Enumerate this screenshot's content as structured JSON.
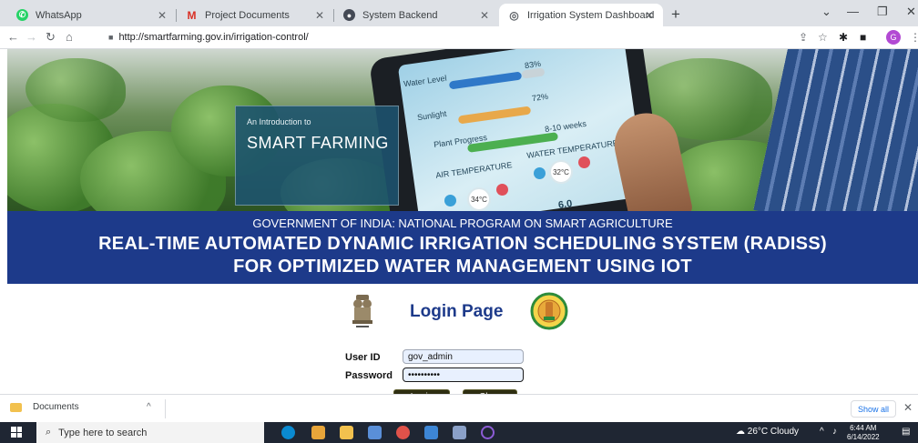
{
  "browser": {
    "tabs": [
      {
        "label": "WhatsApp",
        "icon": "whatsapp-icon",
        "color": "#25d366",
        "active": false
      },
      {
        "label": "Project Documents",
        "icon": "gmail-icon",
        "color": "#d93025",
        "active": false
      },
      {
        "label": "System Backend",
        "icon": "app-icon",
        "color": "#444a55",
        "active": false
      },
      {
        "label": "Irrigation System Dashboard",
        "icon": "globe-icon",
        "color": "#5f6368",
        "active": true
      }
    ],
    "new_tab": "+",
    "url": "http://smartfarming.gov.in/irrigation-control/",
    "profile_initial": "G"
  },
  "banner": {
    "intro_small": "An Introduction to",
    "intro_big": "SMART FARMING",
    "tablet": {
      "water_level": "Water Level",
      "water_pct": "83%",
      "sunlight": "Sunlight",
      "sun_pct": "72%",
      "plant_progress": "Plant Progress",
      "plant_weeks": "8-10 weeks",
      "water_temp": "WATER TEMPERATURE",
      "water_temp_val": "32°C",
      "air_temp": "AIR TEMPERATURE",
      "air_temp_val": "34°C",
      "ph_val": "6.0"
    }
  },
  "header": {
    "subtitle": "GOVERNMENT OF INDIA: NATIONAL PROGRAM ON SMART AGRICULTURE",
    "title_line1": "REAL-TIME AUTOMATED DYNAMIC IRRIGATION SCHEDULING SYSTEM (RADISS)",
    "title_line2": "FOR OPTIMIZED WATER MANAGEMENT USING IOT"
  },
  "login": {
    "heading": "Login Page",
    "user_id_label": "User ID",
    "user_id_value": "gov_admin",
    "password_label": "Password",
    "password_value": "••••••••••",
    "login_button": "Login",
    "clear_button": "Clear"
  },
  "downloads": {
    "item": "Documents",
    "show_all": "Show all"
  },
  "taskbar": {
    "search_placeholder": "Type here to search",
    "weather": "26°C  Cloudy",
    "time": "6:44 AM",
    "date": "6/14/2022"
  }
}
